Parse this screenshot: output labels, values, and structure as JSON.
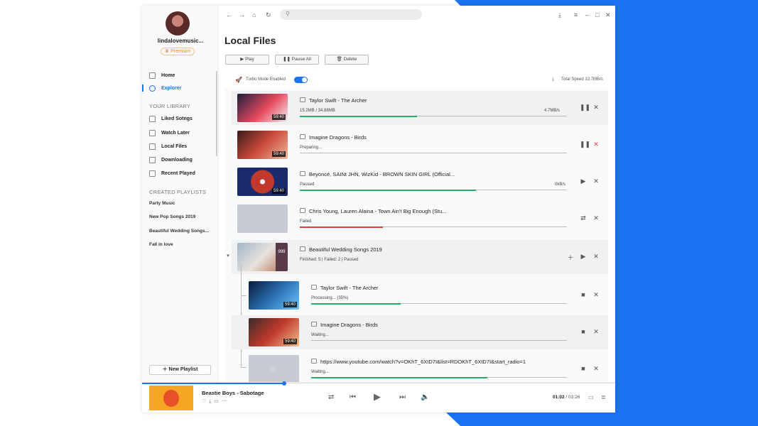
{
  "user": {
    "name": "lindalovemusic...",
    "badge": "Premium"
  },
  "nav": [
    {
      "label": "Home",
      "icon": "home-icon"
    },
    {
      "label": "Explorer",
      "icon": "globe-icon"
    }
  ],
  "library": {
    "heading": "YOUR LIBRARY",
    "items": [
      {
        "label": "Liked Sotngs",
        "icon": "heart-icon"
      },
      {
        "label": "Watch Later",
        "icon": "clock-icon"
      },
      {
        "label": "Local Files",
        "icon": "folder-icon"
      },
      {
        "label": "Downloading",
        "icon": "download-icon"
      },
      {
        "label": "Recent Played",
        "icon": "history-icon"
      }
    ]
  },
  "playlists": {
    "heading": "CREATED PLAYLISTS",
    "items": [
      "Party Music",
      "New Pop Songs 2019",
      "Beautiful Wedding Songs...",
      "Fall in love"
    ]
  },
  "new_playlist": "New Playlist",
  "page": {
    "title": "Local Files",
    "play": "Play",
    "pause_all": "Pause All",
    "delete": "Delete",
    "turbo": "Turbo Mode Enabled",
    "total_speed": "Total Speed 12.7MB/s"
  },
  "tasks": [
    {
      "name": "Taylor Swift - The Archer",
      "status": "15.2MB / 34.88MB",
      "rate": "4.7MB/s",
      "duration": "59:40",
      "progress": 0.44
    },
    {
      "name": "Imagine Dragons - Birds",
      "status": "Preparing...",
      "rate": "",
      "duration": "59:40",
      "progress": 0
    },
    {
      "name": "Beyoncé, SAINt JHN, WizKid - BROWN SKIN GIRL (Official...",
      "status": "Paused",
      "rate": "0kB/s",
      "duration": "59:40",
      "progress": 0.66
    },
    {
      "name": "Chris Young, Lauren Alaina - Town Ain't Big Enough (Stu...",
      "status": "Failed",
      "rate": "",
      "duration": "",
      "progress": 0.31
    }
  ],
  "group": {
    "name": "Beautiful Wedding Songs 2019",
    "count": "999",
    "status": "Finished: 5  |  Failed: 2  |  Paused",
    "items": [
      {
        "name": "Taylor Swift - The Archer",
        "status": "Processing... (35%)",
        "duration": "59:40",
        "progress": 0.35
      },
      {
        "name": "Imagine Dragons - Birds",
        "status": "Waiting...",
        "duration": "59:40",
        "progress": 0
      },
      {
        "name": "https://www.youtube.com/watch?v=OKhT_6XtD7I&list=RDOKhT_6XtD7I&start_radio=1",
        "status": "Waiting...",
        "duration": "",
        "progress": 0.69
      }
    ]
  },
  "player": {
    "title": "Beastie Boys - Sabotage",
    "current": "01:02",
    "total": "03:26",
    "seek_progress": 0.3
  },
  "colors": {
    "accent": "#1a73f0",
    "success": "#27ae60",
    "error": "#e53935"
  }
}
